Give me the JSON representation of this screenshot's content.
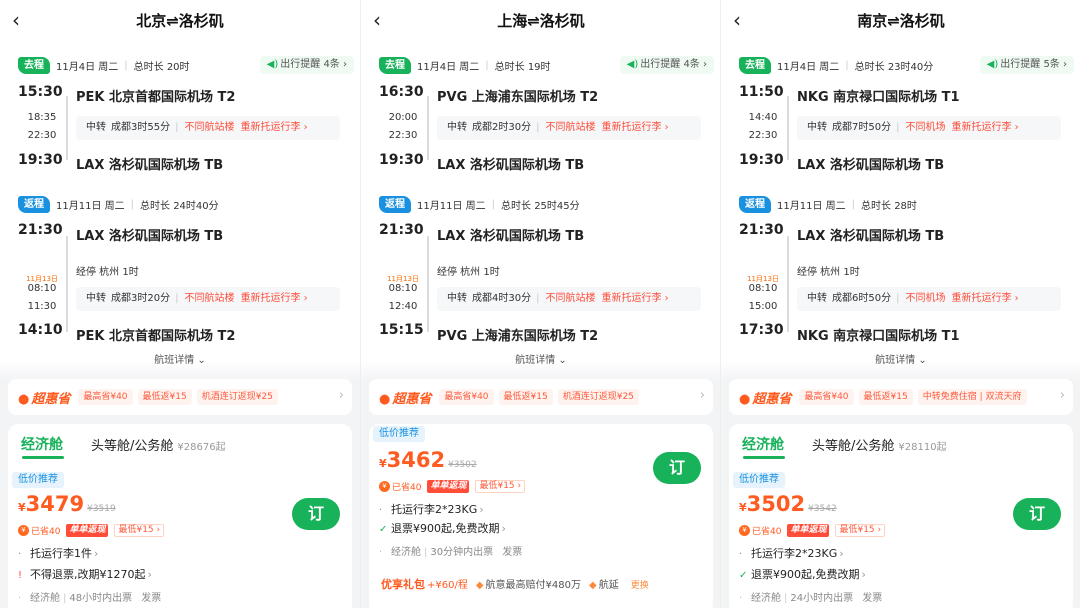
{
  "panels": [
    {
      "title": "北京⇌洛杉矶",
      "outbound": {
        "tag": "去程",
        "date": "11月4日 周二",
        "duration": "总时长 20时",
        "reminder": "出行提醒 4条",
        "dep_time": "15:30",
        "dep_airport": "PEK 北京首都国际机场 T2",
        "transfer_arr": "18:35",
        "transfer_dep": "22:30",
        "transfer_label": "中转",
        "transfer_city": "成都3时55分",
        "transfer_warn": "不同航站楼",
        "transfer_recheck": "重新托运行李",
        "arr_time": "19:30",
        "arr_airport": "LAX 洛杉矶国际机场 TB"
      },
      "return": {
        "tag": "返程",
        "date": "11月11日 周二",
        "duration": "总时长 24时40分",
        "dep_time": "21:30",
        "dep_airport": "LAX 洛杉矶国际机场 TB",
        "stopover": "经停 杭州 1时",
        "date_tag": "11月13日",
        "transfer_arr": "08:10",
        "transfer_dep": "11:30",
        "transfer_label": "中转",
        "transfer_city": "成都3时20分",
        "transfer_warn": "不同航站楼",
        "transfer_recheck": "重新托运行李",
        "arr_time": "14:10",
        "arr_airport": "PEK 北京首都国际机场 T2"
      },
      "details": "航班详情",
      "promo": {
        "logo": "超惠省",
        "chips": [
          "最高省¥40",
          "最低返¥15",
          "机酒连订返现¥25"
        ]
      },
      "card": {
        "econ_tab": "经济舱",
        "first_tab": "头等舱/公务舱",
        "first_price": "¥28676起",
        "low_tag": "低价推荐",
        "currency": "¥",
        "price": "3479",
        "orig_price": "¥3519",
        "saved": "已省40",
        "min_return": "最低¥15",
        "order": "订",
        "rules": [
          {
            "icon": "·",
            "text": "托运行李1件"
          },
          {
            "icon": "!",
            "text": "不得退票,改期¥1270起"
          }
        ],
        "meta_cabin": "经济舱",
        "meta_ticket": "48小时内出票",
        "meta_invoice": "发票"
      }
    },
    {
      "title": "上海⇌洛杉矶",
      "outbound": {
        "tag": "去程",
        "date": "11月4日 周二",
        "duration": "总时长 19时",
        "reminder": "出行提醒 4条",
        "dep_time": "16:30",
        "dep_airport": "PVG 上海浦东国际机场 T2",
        "transfer_arr": "20:00",
        "transfer_dep": "22:30",
        "transfer_label": "中转",
        "transfer_city": "成都2时30分",
        "transfer_warn": "不同航站楼",
        "transfer_recheck": "重新托运行李",
        "arr_time": "19:30",
        "arr_airport": "LAX 洛杉矶国际机场 TB"
      },
      "return": {
        "tag": "返程",
        "date": "11月11日 周二",
        "duration": "总时长 25时45分",
        "dep_time": "21:30",
        "dep_airport": "LAX 洛杉矶国际机场 TB",
        "stopover": "经停 杭州 1时",
        "date_tag": "11月13日",
        "transfer_arr": "08:10",
        "transfer_dep": "12:40",
        "transfer_label": "中转",
        "transfer_city": "成都4时30分",
        "transfer_warn": "不同航站楼",
        "transfer_recheck": "重新托运行李",
        "arr_time": "15:15",
        "arr_airport": "PVG 上海浦东国际机场 T2"
      },
      "details": "航班详情",
      "promo": {
        "logo": "超惠省",
        "chips": [
          "最高省¥40",
          "最低返¥15",
          "机酒连订返现¥25"
        ]
      },
      "card": {
        "low_tag": "低价推荐",
        "currency": "¥",
        "price": "3462",
        "orig_price": "¥3502",
        "saved": "已省40",
        "min_return": "最低¥15",
        "order": "订",
        "rules": [
          {
            "icon": "·",
            "text": "托运行李2*23KG"
          },
          {
            "icon": "✓",
            "text": "退票¥900起,免费改期"
          }
        ],
        "meta_cabin": "经济舱",
        "meta_ticket": "30分钟内出票",
        "meta_invoice": "发票",
        "gift_title": "优享礼包",
        "gift_price": "+¥60/程",
        "gift_item1": "航意最高赔付¥480万",
        "gift_item2": "航延",
        "gift_swap": "更换"
      }
    },
    {
      "title": "南京⇌洛杉矶",
      "outbound": {
        "tag": "去程",
        "date": "11月4日 周二",
        "duration": "总时长 23时40分",
        "reminder": "出行提醒 5条",
        "dep_time": "11:50",
        "dep_airport": "NKG 南京禄口国际机场 T1",
        "transfer_arr": "14:40",
        "transfer_dep": "22:30",
        "transfer_label": "中转",
        "transfer_city": "成都7时50分",
        "transfer_warn": "不同机场",
        "transfer_recheck": "重新托运行李",
        "arr_time": "19:30",
        "arr_airport": "LAX 洛杉矶国际机场 TB"
      },
      "return": {
        "tag": "返程",
        "date": "11月11日 周二",
        "duration": "总时长 28时",
        "dep_time": "21:30",
        "dep_airport": "LAX 洛杉矶国际机场 TB",
        "stopover": "经停 杭州 1时",
        "date_tag": "11月13日",
        "transfer_arr": "08:10",
        "transfer_dep": "15:00",
        "transfer_label": "中转",
        "transfer_city": "成都6时50分",
        "transfer_warn": "不同机场",
        "transfer_recheck": "重新托运行李",
        "arr_time": "17:30",
        "arr_airport": "NKG 南京禄口国际机场 T1"
      },
      "details": "航班详情",
      "promo": {
        "logo": "超惠省",
        "chips": [
          "最高省¥40",
          "最低返¥15",
          "中转免费住宿 | 双流天府"
        ]
      },
      "card": {
        "econ_tab": "经济舱",
        "first_tab": "头等舱/公务舱",
        "first_price": "¥28110起",
        "low_tag": "低价推荐",
        "currency": "¥",
        "price": "3502",
        "orig_price": "¥3542",
        "saved": "已省40",
        "min_return": "最低¥15",
        "order": "订",
        "rules": [
          {
            "icon": "·",
            "text": "托运行李2*23KG"
          },
          {
            "icon": "✓",
            "text": "退票¥900起,免费改期"
          }
        ],
        "meta_cabin": "经济舱",
        "meta_ticket": "24小时内出票",
        "meta_invoice": "发票"
      }
    }
  ],
  "flash_badge": "单单返现",
  "colors": {
    "brand_green": "#18b25a",
    "return_blue": "#1a91e0",
    "price_orange": "#ff5a1f",
    "warn_red": "#ff4d3a"
  }
}
